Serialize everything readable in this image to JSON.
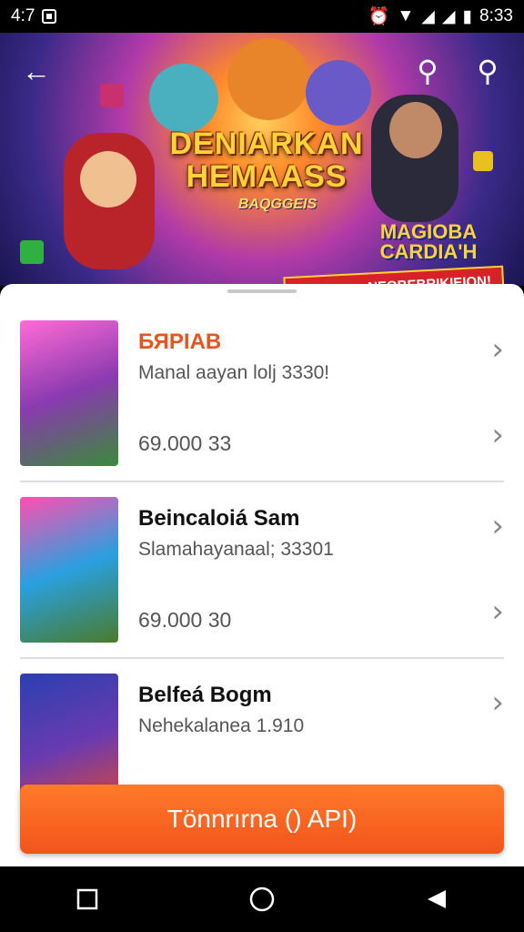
{
  "status_bar": {
    "time": "4:7",
    "right_time": "8:33"
  },
  "banner": {
    "back_icon": "back-arrow-icon",
    "search_icons": [
      "search-icon",
      "search-icon"
    ],
    "title": "DENIARKAN HEMAASS",
    "subtitle": "BAQGGEIS",
    "badge": "MAGIOBA CARDIA'H",
    "ribbon": "Perragann NEOBEBRIKIEION!"
  },
  "list": [
    {
      "title": "БЯPIAB",
      "subtitle": "Manal aayan lolj 3330!",
      "price": "69.000  33",
      "accent": true,
      "thumb_colors": [
        "#ff6bd6",
        "#3a8a3a"
      ]
    },
    {
      "title": "Beincaloiá Sam",
      "subtitle": "Slamahayanaal; 33301",
      "price": "69.000  30",
      "accent": false,
      "thumb_colors": [
        "#ff4fb0",
        "#2aa0e0"
      ]
    },
    {
      "title": "Belfeá Bogm",
      "subtitle": "Nehekalanea 1.910",
      "price": "",
      "accent": false,
      "thumb_colors": [
        "#2a40b0",
        "#e84a2a"
      ]
    }
  ],
  "cta": {
    "label": "Tönnrırna () API)"
  },
  "colors": {
    "accent": "#f2541c",
    "cta": "#ff6a24"
  }
}
